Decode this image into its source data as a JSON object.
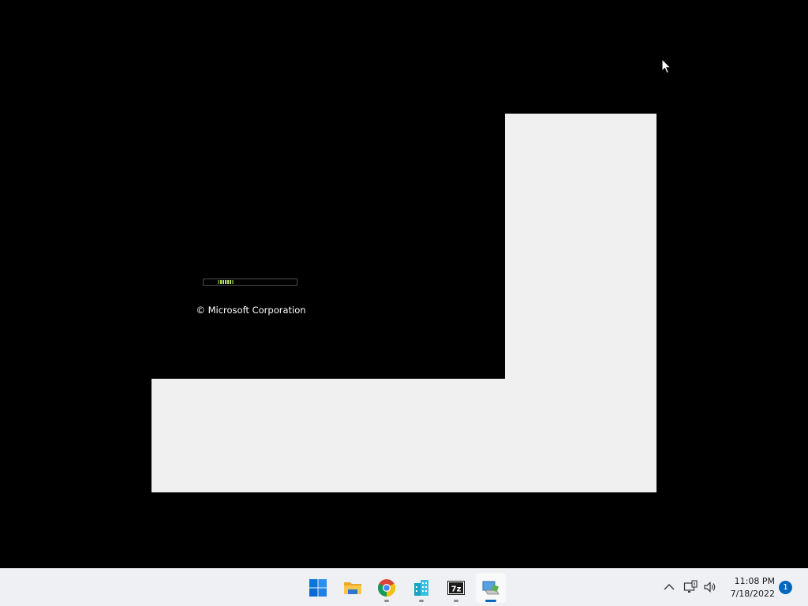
{
  "boot_splash": {
    "copyright": "© Microsoft Corporation"
  },
  "taskbar": {
    "apps": [
      {
        "name": "Start",
        "icon": "windows-logo-icon",
        "running": false
      },
      {
        "name": "File Explorer",
        "icon": "folder-icon",
        "running": false
      },
      {
        "name": "Google Chrome",
        "icon": "chrome-icon",
        "running": true
      },
      {
        "name": "Buildings app",
        "icon": "buildings-icon",
        "running": true
      },
      {
        "name": "7-Zip",
        "icon": "7zip-icon",
        "label": "7z",
        "running": true
      },
      {
        "name": "Installer",
        "icon": "installer-icon",
        "running": true,
        "active": true
      }
    ],
    "tray": {
      "overflow_icon": "chevron-up-icon",
      "network_icon": "network-icon",
      "volume_icon": "speaker-icon",
      "time": "11:08 PM",
      "date": "7/18/2022",
      "notification_count": "1"
    }
  },
  "colors": {
    "desktop": "#000000",
    "window_unpainted": "#f0f0f0",
    "taskbar": "#eef0f3",
    "accent": "#0067c0",
    "progress_green": "#b7e36a"
  }
}
